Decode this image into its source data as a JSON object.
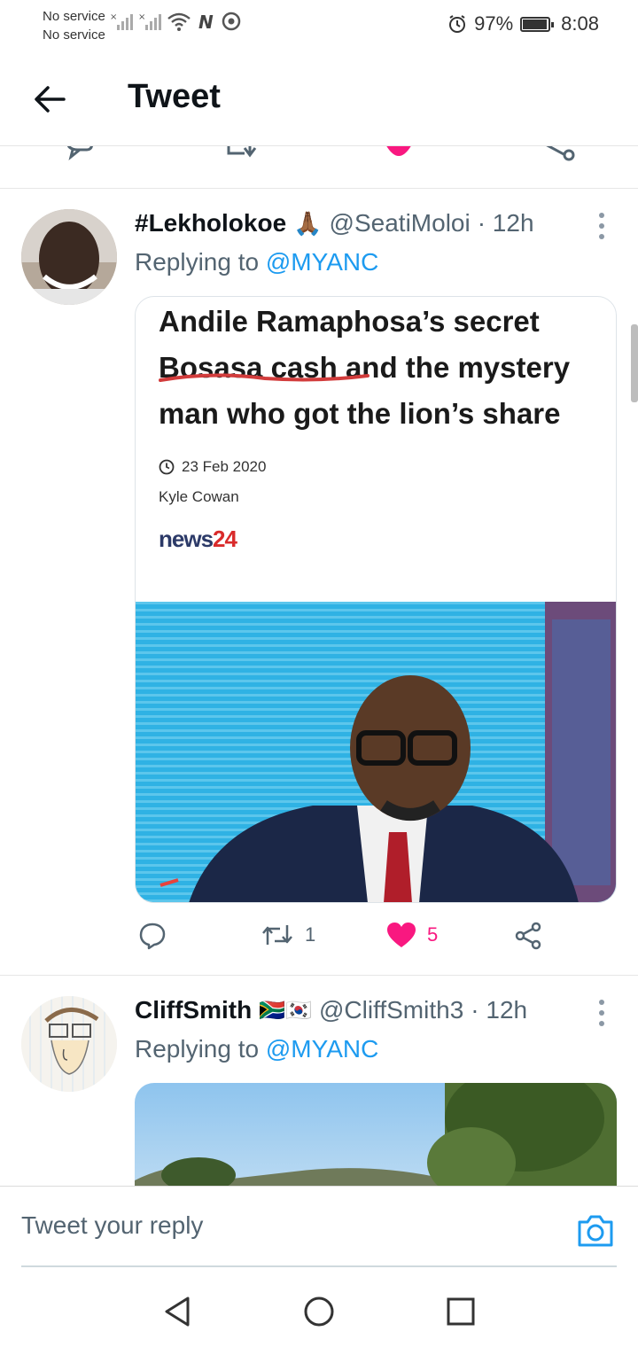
{
  "status_bar": {
    "carrier_line1": "No service",
    "carrier_line2": "No service",
    "battery": "97%",
    "battery_level": 0.97,
    "time": "8:08"
  },
  "header": {
    "title": "Tweet"
  },
  "tweets": [
    {
      "display_name": "#Lekholokoe",
      "emoji": "🙏🏾",
      "handle": "@SeatiMoloi",
      "time": "· 12h",
      "replying_prefix": "Replying to",
      "replying_to": "@MYANC",
      "card": {
        "headline": "Andile Ramaphosa’s secret Bosasa cash and the mystery man who got the lion’s share",
        "date": "23 Feb 2020",
        "author": "Kyle Cowan",
        "source_part1": "news",
        "source_part2": "24"
      },
      "retweets": "1",
      "likes": "5"
    },
    {
      "display_name": "CliffSmith",
      "emoji": "🇿🇦🇰🇷",
      "handle": "@CliffSmith3",
      "time": "· 12h",
      "replying_prefix": "Replying to",
      "replying_to": "@MYANC"
    }
  ],
  "composer": {
    "placeholder": "Tweet your reply"
  },
  "colors": {
    "accent": "#1d9bf0",
    "like": "#f91880",
    "muted": "#536471"
  }
}
